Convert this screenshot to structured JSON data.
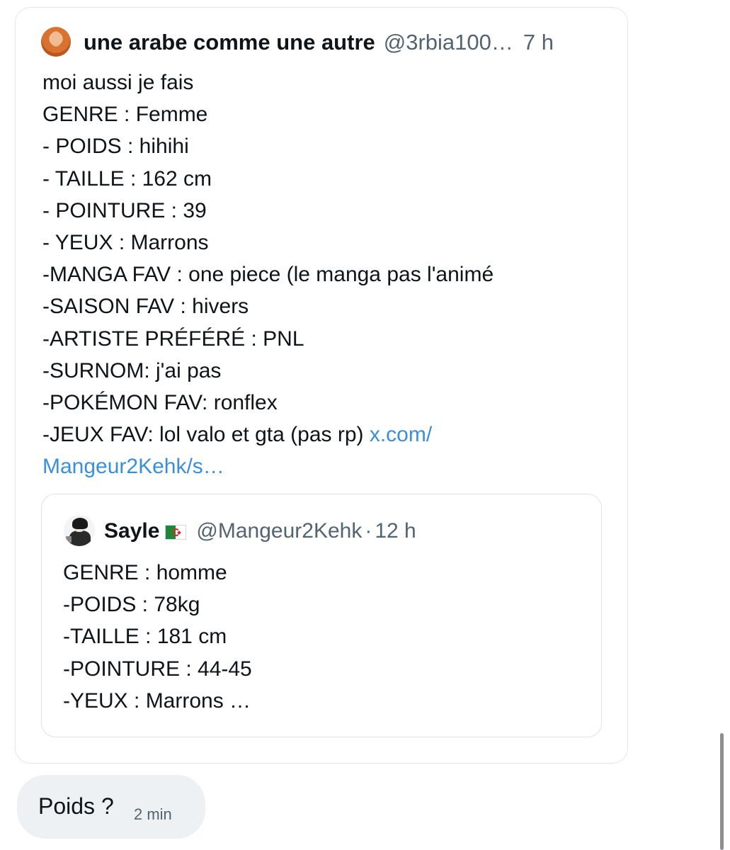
{
  "tweet": {
    "author_name": "une arabe comme une autre",
    "author_handle": "@3rbia100…",
    "separator": "·",
    "time": "7 h",
    "avatar_icon": "avatar-orange-hair",
    "lines": [
      "moi aussi je fais",
      "GENRE : Femme",
      "- POIDS : hihihi",
      "- TAILLE : 162 cm",
      "- POINTURE : 39",
      "- YEUX : Marrons",
      "-MANGA FAV : one piece (le manga pas l'animé",
      "-SAISON FAV : hivers",
      "-ARTISTE PRÉFÉRÉ : PNL",
      "-SURNOM: j'ai pas",
      "-POKÉMON FAV:  ronflex"
    ],
    "last_line_text": "-JEUX FAV: lol valo et gta (pas rp) ",
    "link_part1": "x.com/",
    "link_part2": "Mangeur2Kehk/s…",
    "link_color": "#3a8fd6"
  },
  "quote": {
    "author_name": "Sayle",
    "flag_icon": "algeria-flag-icon",
    "author_handle": "@Mangeur2Kehk",
    "separator": "·",
    "time": "12 h",
    "lines": [
      "GENRE : homme",
      "-POIDS : 78kg",
      "-TAILLE : 181 cm",
      "-POINTURE : 44-45",
      "-YEUX : Marrons …"
    ]
  },
  "reply": {
    "text": "Poids ?",
    "time": "2 min"
  },
  "colors": {
    "text_primary": "#0f1419",
    "text_secondary": "#536471",
    "bubble_bg": "#eef1f3",
    "border": "#e3e6e9"
  }
}
